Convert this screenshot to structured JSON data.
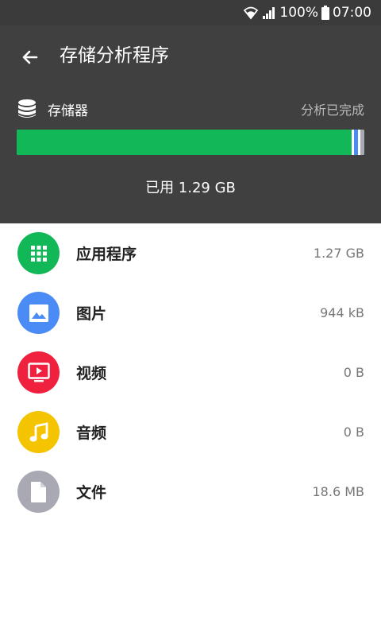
{
  "status_bar": {
    "battery_text": "100%",
    "time": "07:00"
  },
  "header": {
    "title": "存储分析程序",
    "storage_label": "存储器",
    "analysis_status": "分析已完成",
    "used_text": "已用 1.29 GB",
    "usage_fraction_apps": 0.97
  },
  "categories": [
    {
      "label": "应用程序",
      "size": "1.27 GB",
      "color": "#12b857",
      "icon": "apps-grid-icon"
    },
    {
      "label": "图片",
      "size": "944 kB",
      "color": "#4a8bf5",
      "icon": "image-icon"
    },
    {
      "label": "视频",
      "size": "0 B",
      "color": "#f0203f",
      "icon": "video-icon"
    },
    {
      "label": "音频",
      "size": "0 B",
      "color": "#f5c400",
      "icon": "music-note-icon"
    },
    {
      "label": "文件",
      "size": "18.6 MB",
      "color": "#a9a9b3",
      "icon": "file-icon"
    }
  ]
}
